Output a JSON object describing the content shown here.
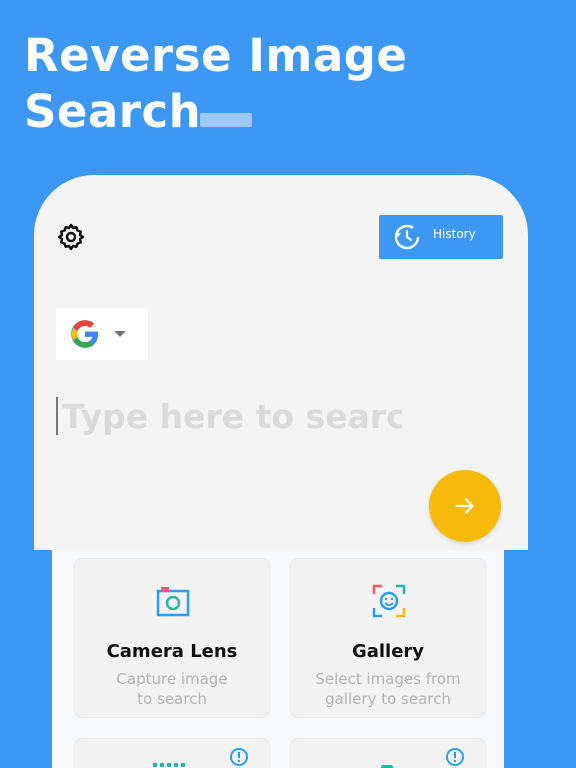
{
  "headline": {
    "line1": "Reverse Image",
    "line2": "Search"
  },
  "toolbar": {
    "history_label": "History"
  },
  "search": {
    "engine": "google-logo",
    "placeholder": "Type here to search",
    "value": ""
  },
  "tiles": [
    {
      "title": "Camera Lens",
      "desc1": "Capture image",
      "desc2": "to search",
      "icon": "camera-icon"
    },
    {
      "title": "Gallery",
      "desc1": "Select images from",
      "desc2": "gallery to search",
      "icon": "gallery-face-icon"
    }
  ],
  "colors": {
    "background": "#3d98f5",
    "accent_yellow": "#f8ba0a",
    "teal": "#21b8a9"
  }
}
